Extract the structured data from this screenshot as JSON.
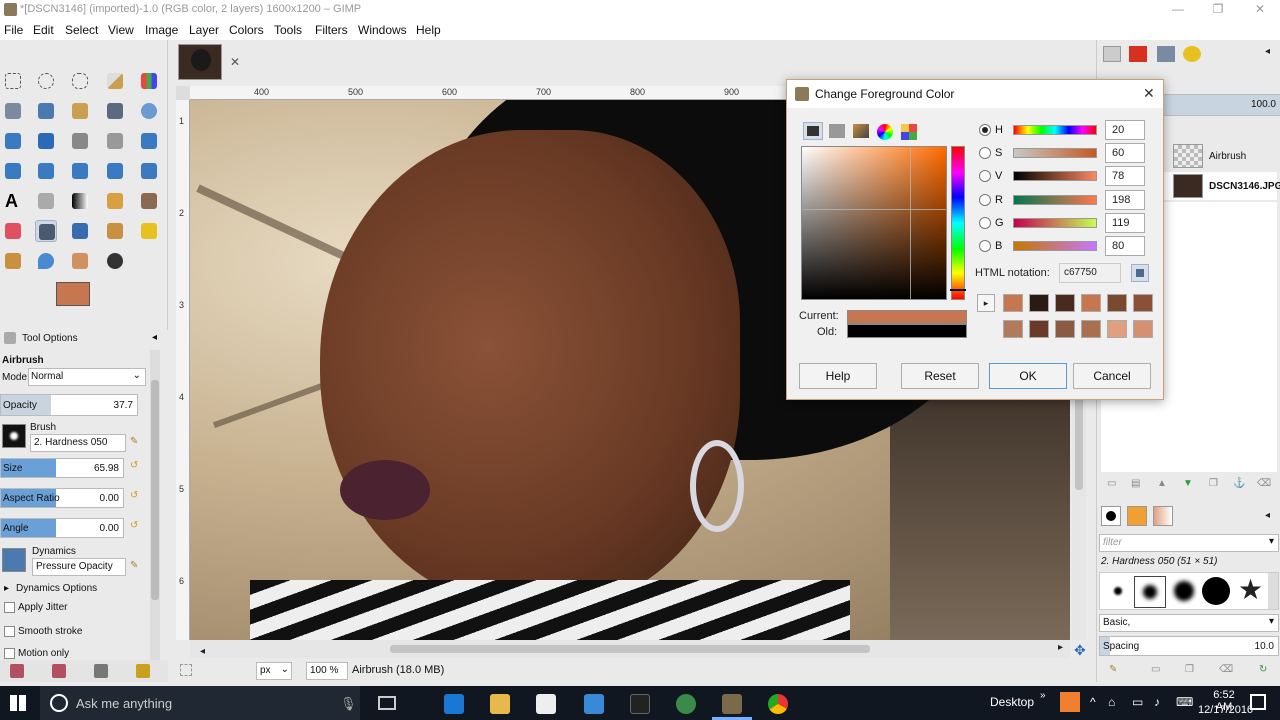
{
  "window": {
    "title": "*[DSCN3146] (imported)-1.0 (RGB color, 2 layers) 1600x1200 – GIMP"
  },
  "menu": [
    "File",
    "Edit",
    "Select",
    "View",
    "Image",
    "Layer",
    "Colors",
    "Tools",
    "Filters",
    "Windows",
    "Help"
  ],
  "colors": {
    "foreground": "#c67750",
    "background": "#ffffff",
    "current": "#c67750",
    "old": "#000000"
  },
  "tool_options": {
    "header": "Tool Options",
    "tool_name": "Airbrush",
    "mode_label": "Mode:",
    "mode_value": "Normal",
    "opacity_label": "Opacity",
    "opacity_value": "37.7",
    "brush_label": "Brush",
    "brush_value": "2. Hardness 050",
    "size_label": "Size",
    "size_value": "65.98",
    "aspect_label": "Aspect Ratio",
    "aspect_value": "0.00",
    "angle_label": "Angle",
    "angle_value": "0.00",
    "dynamics_label": "Dynamics",
    "dynamics_value": "Pressure Opacity",
    "dynamics_options": "Dynamics Options",
    "apply_jitter": "Apply Jitter",
    "smooth_stroke": "Smooth stroke",
    "motion_only": "Motion only"
  },
  "rulers": {
    "h_ticks": [
      "400",
      "500",
      "600",
      "700",
      "800",
      "900"
    ],
    "v_ticks": [
      "1",
      "2",
      "3",
      "4",
      "5",
      "6",
      "7"
    ]
  },
  "status": {
    "unit": "px",
    "zoom": "100 %",
    "info": "Airbrush (18.0 MB)"
  },
  "layers": {
    "opacity_value": "100.0",
    "items": [
      {
        "name": "Airbrush"
      },
      {
        "name": "DSCN3146.JPG"
      }
    ]
  },
  "brushes": {
    "filter_placeholder": "filter",
    "current_brush": "2. Hardness 050 (51 × 51)",
    "preset": "Basic,",
    "spacing_label": "Spacing",
    "spacing_value": "10.0"
  },
  "dialog": {
    "title": "Change Foreground Color",
    "channels": [
      {
        "label": "H",
        "value": "20",
        "selected": true
      },
      {
        "label": "S",
        "value": "60",
        "selected": false
      },
      {
        "label": "V",
        "value": "78",
        "selected": false
      },
      {
        "label": "R",
        "value": "198",
        "selected": false
      },
      {
        "label": "G",
        "value": "119",
        "selected": false
      },
      {
        "label": "B",
        "value": "80",
        "selected": false
      }
    ],
    "html_notation_label": "HTML notation:",
    "html_notation_value": "c67750",
    "current_label": "Current:",
    "old_label": "Old:",
    "history_colors": [
      "#c67750",
      "#2a1a14",
      "#4a2a1e",
      "#c67750",
      "#7a4a30",
      "#8a5038",
      "#b27a5c",
      "#6a3a28",
      "#8a5a42",
      "#a8704e",
      "#e0a080",
      "#d49070"
    ],
    "buttons": {
      "help": "Help",
      "reset": "Reset",
      "ok": "OK",
      "cancel": "Cancel"
    }
  },
  "taskbar": {
    "search_placeholder": "Ask me anything",
    "desktop_label": "Desktop",
    "time": "6:52 AM",
    "date": "12/17/2016"
  }
}
